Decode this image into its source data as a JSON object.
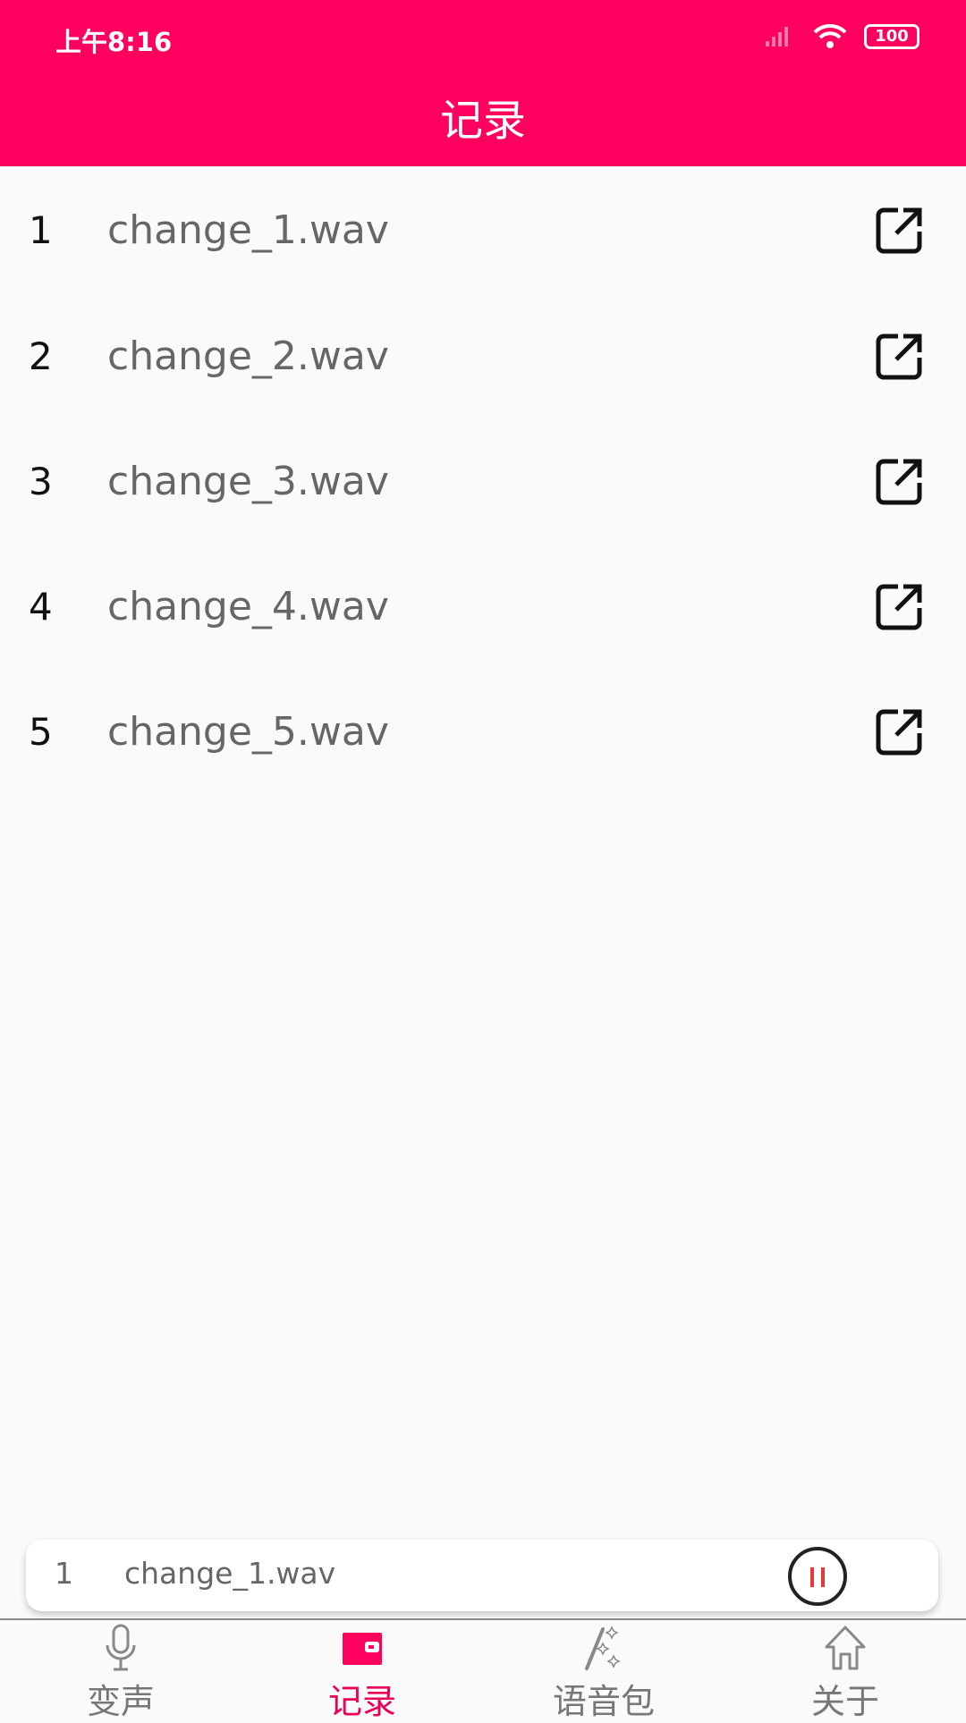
{
  "status_bar": {
    "time": "上午8:16",
    "battery": "100"
  },
  "header": {
    "title": "记录"
  },
  "records": [
    {
      "index": "1",
      "name": "change_1.wav"
    },
    {
      "index": "2",
      "name": "change_2.wav"
    },
    {
      "index": "3",
      "name": "change_3.wav"
    },
    {
      "index": "4",
      "name": "change_4.wav"
    },
    {
      "index": "5",
      "name": "change_5.wav"
    }
  ],
  "player": {
    "index": "1",
    "name": "change_1.wav",
    "state": "playing",
    "icon": "pause-icon"
  },
  "nav": {
    "tabs": [
      {
        "label": "变声",
        "icon": "microphone-icon"
      },
      {
        "label": "记录",
        "icon": "wallet-icon",
        "active": true
      },
      {
        "label": "语音包",
        "icon": "magic-wand-icon"
      },
      {
        "label": "关于",
        "icon": "home-icon"
      }
    ]
  },
  "colors": {
    "accent": "#ff005f",
    "inactive": "#777777"
  }
}
